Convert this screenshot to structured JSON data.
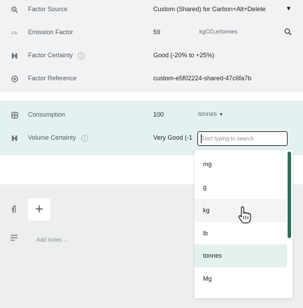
{
  "factor_rows": [
    {
      "icon": "factor-source-icon",
      "label": "Factor Source",
      "value": "Custom (Shared) for Carbon+Alt+Delete"
    },
    {
      "icon": "emission-factor-icon",
      "label": "Emission Factor",
      "value": "59",
      "unit": "kgCO₂e/tonnes"
    },
    {
      "icon": "certainty-icon",
      "label": "Factor Certainty",
      "value": "Good (-20% to +25%)"
    },
    {
      "icon": "reference-icon",
      "label": "Factor Reference",
      "value": "custom-e5f02224-shared-47c6fa7b"
    }
  ],
  "consumption": {
    "label": "Consumption",
    "value": "100",
    "unit_selected": "tonnes"
  },
  "volume_certainty": {
    "label": "Volume Certainty",
    "value": "Very Good (-1"
  },
  "unit_search": {
    "placeholder": "Start typing to search"
  },
  "unit_options": [
    {
      "label": "mg",
      "state": "normal"
    },
    {
      "label": "g",
      "state": "normal"
    },
    {
      "label": "kg",
      "state": "hover"
    },
    {
      "label": "lb",
      "state": "normal"
    },
    {
      "label": "tonnes",
      "state": "selected"
    },
    {
      "label": "Mg",
      "state": "normal"
    }
  ],
  "attachments": {
    "add_label": "+"
  },
  "notes": {
    "placeholder": "Add notes ..."
  },
  "colors": {
    "accent": "#2d6e5c",
    "selected_bg": "#e3f1ef",
    "panel_bg": "#e4f1f0"
  }
}
